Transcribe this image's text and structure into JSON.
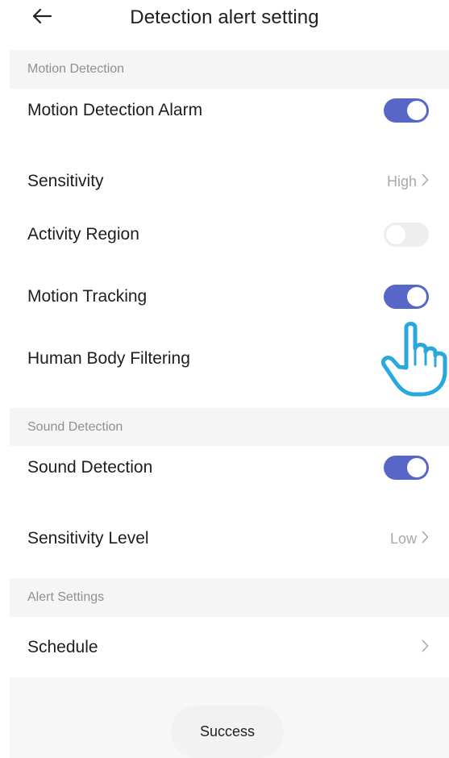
{
  "header": {
    "title": "Detection alert setting",
    "back_icon": "back-arrow-icon"
  },
  "sections": {
    "motion": {
      "title": "Motion Detection",
      "items": {
        "alarm": {
          "label": "Motion Detection Alarm",
          "enabled": true
        },
        "sensitivity": {
          "label": "Sensitivity",
          "value": "High"
        },
        "activity_region": {
          "label": "Activity Region",
          "enabled": false
        },
        "tracking": {
          "label": "Motion Tracking",
          "enabled": true
        },
        "human_filter": {
          "label": "Human Body Filtering"
        }
      }
    },
    "sound": {
      "title": "Sound Detection",
      "items": {
        "detection": {
          "label": "Sound Detection",
          "enabled": true
        },
        "level": {
          "label": "Sensitivity Level",
          "value": "Low"
        }
      }
    },
    "alert": {
      "title": "Alert Settings",
      "items": {
        "schedule": {
          "label": "Schedule"
        }
      }
    }
  },
  "toast": {
    "text": "Success"
  },
  "colors": {
    "accent": "#5867c7",
    "toggle_off": "#eeeeee",
    "section_bg": "#f5f5f5",
    "hand_outline": "#29a8dd"
  },
  "overlay": {
    "pointer_icon": "hand-pointer-icon"
  }
}
